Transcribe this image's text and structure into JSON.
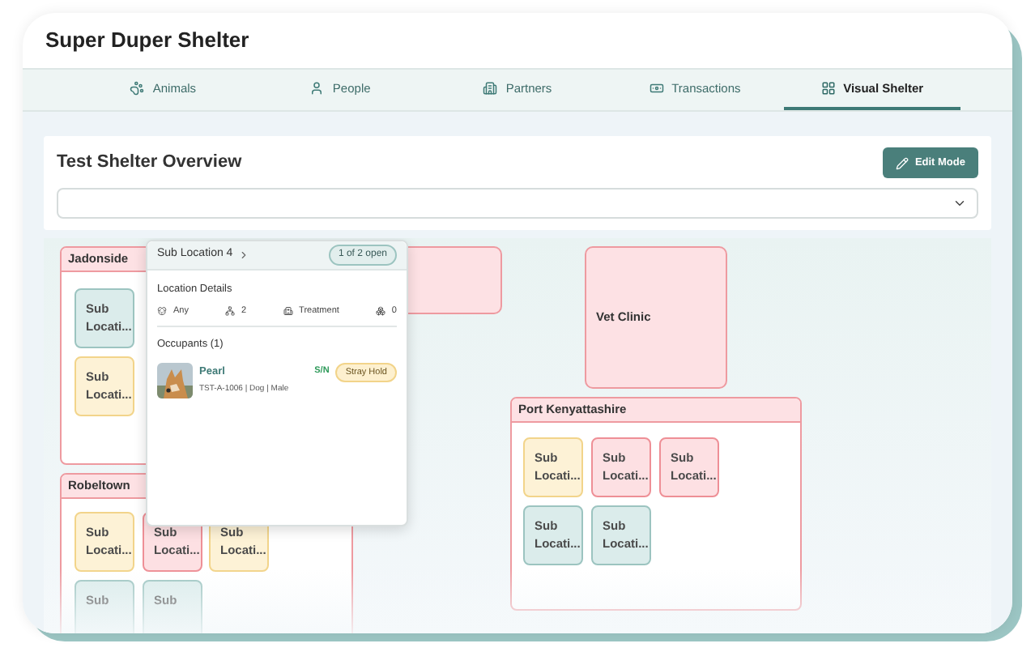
{
  "app_title": "Super Duper Shelter",
  "tabs": [
    {
      "label": "Animals",
      "selected": false
    },
    {
      "label": "People",
      "selected": false
    },
    {
      "label": "Partners",
      "selected": false
    },
    {
      "label": "Transactions",
      "selected": false
    },
    {
      "label": "Visual Shelter",
      "selected": true
    }
  ],
  "overview": {
    "title": "Test Shelter Overview",
    "edit_button": "Edit Mode"
  },
  "locations": [
    {
      "name": "Jadonside",
      "kind": "group",
      "subs": [
        {
          "label": "Sub Locati...",
          "color": "#dbeceb"
        },
        {
          "label": "Sub Locati...",
          "color": "#fdf2d6"
        }
      ]
    },
    {
      "name": "Robeltown",
      "kind": "group",
      "subs": [
        {
          "label": "Sub Locati...",
          "color": "#fdf2d6"
        },
        {
          "label": "Sub Locati...",
          "color": "#fde0e3"
        },
        {
          "label": "Sub Locati...",
          "color": "#fdf2d6"
        },
        {
          "label": "Sub",
          "color": "#dbeceb"
        },
        {
          "label": "Sub",
          "color": "#dbeceb"
        }
      ]
    },
    {
      "kind": "room"
    },
    {
      "name": "Vet Clinic",
      "kind": "room"
    },
    {
      "name": "Port Kenyattashire",
      "kind": "group",
      "subs": [
        {
          "label": "Sub Locati...",
          "color": "#fdf2d6"
        },
        {
          "label": "Sub Locati...",
          "color": "#fde0e3"
        },
        {
          "label": "Sub Locati...",
          "color": "#fde0e3"
        },
        {
          "label": "Sub Locati...",
          "color": "#dbeceb"
        },
        {
          "label": "Sub Locati...",
          "color": "#dbeceb"
        }
      ]
    }
  ],
  "popover": {
    "title": "Sub Location 4",
    "badge": "1 of 2 open",
    "details_heading": "Location Details",
    "details": [
      {
        "text": "Any"
      },
      {
        "text": "2"
      },
      {
        "text": "Treatment"
      },
      {
        "text": "0"
      }
    ],
    "occupants_heading": "Occupants (1)",
    "occupants": [
      {
        "name": "Pearl",
        "meta": "TST-A-1006 | Dog | Male",
        "sn": "S/N",
        "status": "Stray Hold"
      }
    ]
  }
}
